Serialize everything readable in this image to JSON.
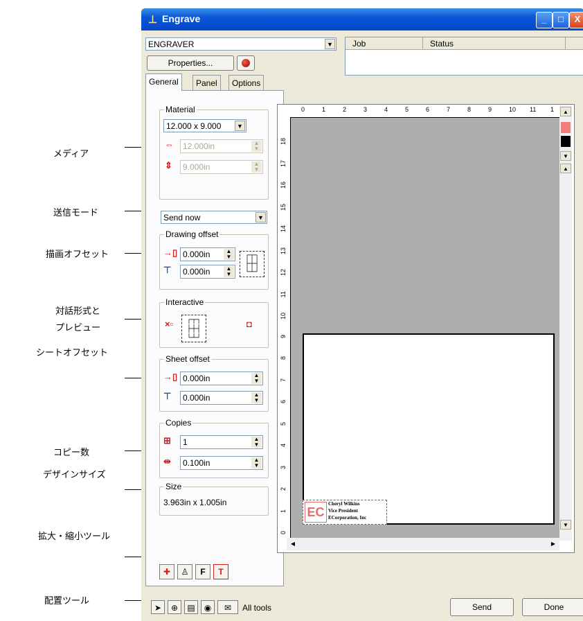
{
  "annotations": [
    {
      "label": "メディア"
    },
    {
      "label": "送信モード"
    },
    {
      "label": "描画オフセット"
    },
    {
      "label": "対話形式と"
    },
    {
      "label": "プレビュー"
    },
    {
      "label": "シートオフセット"
    },
    {
      "label": "コピー数"
    },
    {
      "label": "デザインサイズ"
    },
    {
      "label": "拡大・縮小ツール"
    },
    {
      "label": "配置ツール"
    }
  ],
  "window": {
    "title": "Engrave",
    "title_icon": "engrave-app-icon",
    "controls": [
      "_",
      "□",
      "X"
    ]
  },
  "device": {
    "selected": "ENGRAVER",
    "properties_label": "Properties..."
  },
  "job_list": {
    "columns": [
      "Job",
      "Status"
    ]
  },
  "tabs": [
    {
      "label": "General"
    },
    {
      "label": "Panel"
    },
    {
      "label": "Options"
    }
  ],
  "material": {
    "label": "Material",
    "size": "12.000 x 9.000",
    "width": "12.000in",
    "height": "9.000in"
  },
  "send_mode": {
    "selected": "Send now"
  },
  "drawing_offset": {
    "label": "Drawing offset",
    "x": "0.000in",
    "y": "0.000in"
  },
  "interactive": {
    "label": "Interactive"
  },
  "sheet_offset": {
    "label": "Sheet offset",
    "x": "0.000in",
    "y": "0.000in"
  },
  "copies": {
    "label": "Copies",
    "count": "1",
    "spacing": "0.100in"
  },
  "size": {
    "label": "Size",
    "value": "3.963in x 1.005in"
  },
  "ruler": {
    "x_ticks": [
      "0",
      "1",
      "2",
      "3",
      "4",
      "5",
      "6",
      "7",
      "8",
      "9",
      "10",
      "11",
      "1"
    ],
    "y_ticks": [
      "18",
      "17",
      "16",
      "15",
      "14",
      "13",
      "12",
      "11",
      "10",
      "9",
      "8",
      "7",
      "6",
      "5",
      "4",
      "3",
      "2",
      "1",
      "0"
    ]
  },
  "design": {
    "line1": "Cheryl Wilkins",
    "line2": "Vice President",
    "line3": "ECorporation, Inc"
  },
  "colors": {
    "swatch1": "#f08080",
    "swatch2": "#000000",
    "titlebar": "#0a56d8"
  },
  "bottom": {
    "all_tools": "All tools",
    "send": "Send",
    "done": "Done"
  }
}
